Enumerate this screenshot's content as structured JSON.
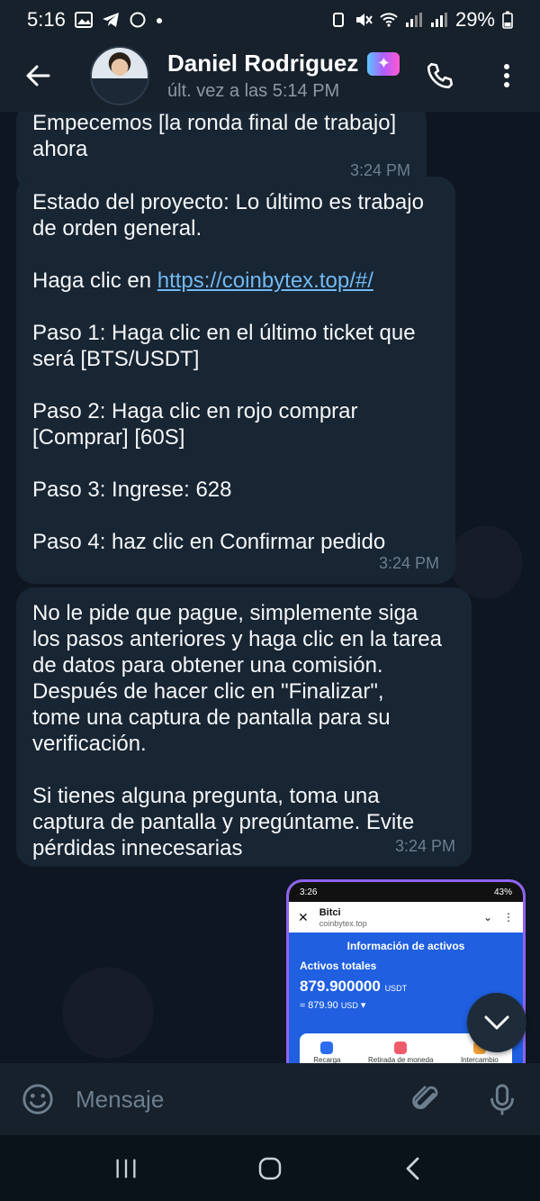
{
  "status_bar": {
    "time": "5:16",
    "battery": "29%"
  },
  "header": {
    "contact_name": "Daniel Rodriguez",
    "last_seen": "últ. vez a las 5:14 PM",
    "icons": [
      "back-arrow-icon",
      "phone-icon",
      "more-vert-icon",
      "premium-badge-icon"
    ]
  },
  "messages": [
    {
      "lines": [
        "Empecemos [la ronda final de trabajo]",
        "ahora"
      ],
      "time": "3:24 PM"
    },
    {
      "intro": [
        "Estado del proyecto: Lo último es trabajo",
        "de orden general."
      ],
      "click_prefix": "Haga clic en ",
      "link": "https://coinbytex.top/#/",
      "step1": [
        "Paso 1: Haga clic en el último ticket que",
        "será [BTS/USDT]"
      ],
      "step2": [
        "Paso 2: Haga clic en rojo comprar",
        "[Comprar] [60S]"
      ],
      "step3": "Paso 3: Ingrese: 628",
      "step4": "Paso 4: haz clic en Confirmar pedido",
      "time": "3:24 PM"
    },
    {
      "para1": [
        "No le pide que pague, simplemente siga",
        "los pasos anteriores y haga clic en la tarea",
        "de datos para obtener una comisión.",
        "Después de hacer clic en \"Finalizar\",",
        "tome una captura de pantalla para su",
        "verificación."
      ],
      "para2": [
        "Si tienes alguna pregunta, toma una",
        "captura de pantalla y pregúntame. Evite",
        "pérdidas innecesarias"
      ],
      "time": "3:24 PM"
    }
  ],
  "image_message": {
    "status_time": "3:26",
    "status_battery": "43%",
    "site_title": "Bitci",
    "site_url": "coinbytex.top",
    "section_title": "Información de activos",
    "total_label": "Activos totales",
    "amount": "879.900000",
    "amount_unit": "USDT",
    "usd_value": "≈ 879.90",
    "usd_unit": "USD",
    "actions": [
      "Recarga",
      "Retirada de moneda",
      "Intercambio"
    ]
  },
  "input_bar": {
    "placeholder": "Mensaje"
  },
  "colors": {
    "header_bg": "#17212b",
    "chat_bg": "#0e1621",
    "bubble_bg": "#182533",
    "link": "#71baf2",
    "accent_purple": "#8f63f2"
  }
}
